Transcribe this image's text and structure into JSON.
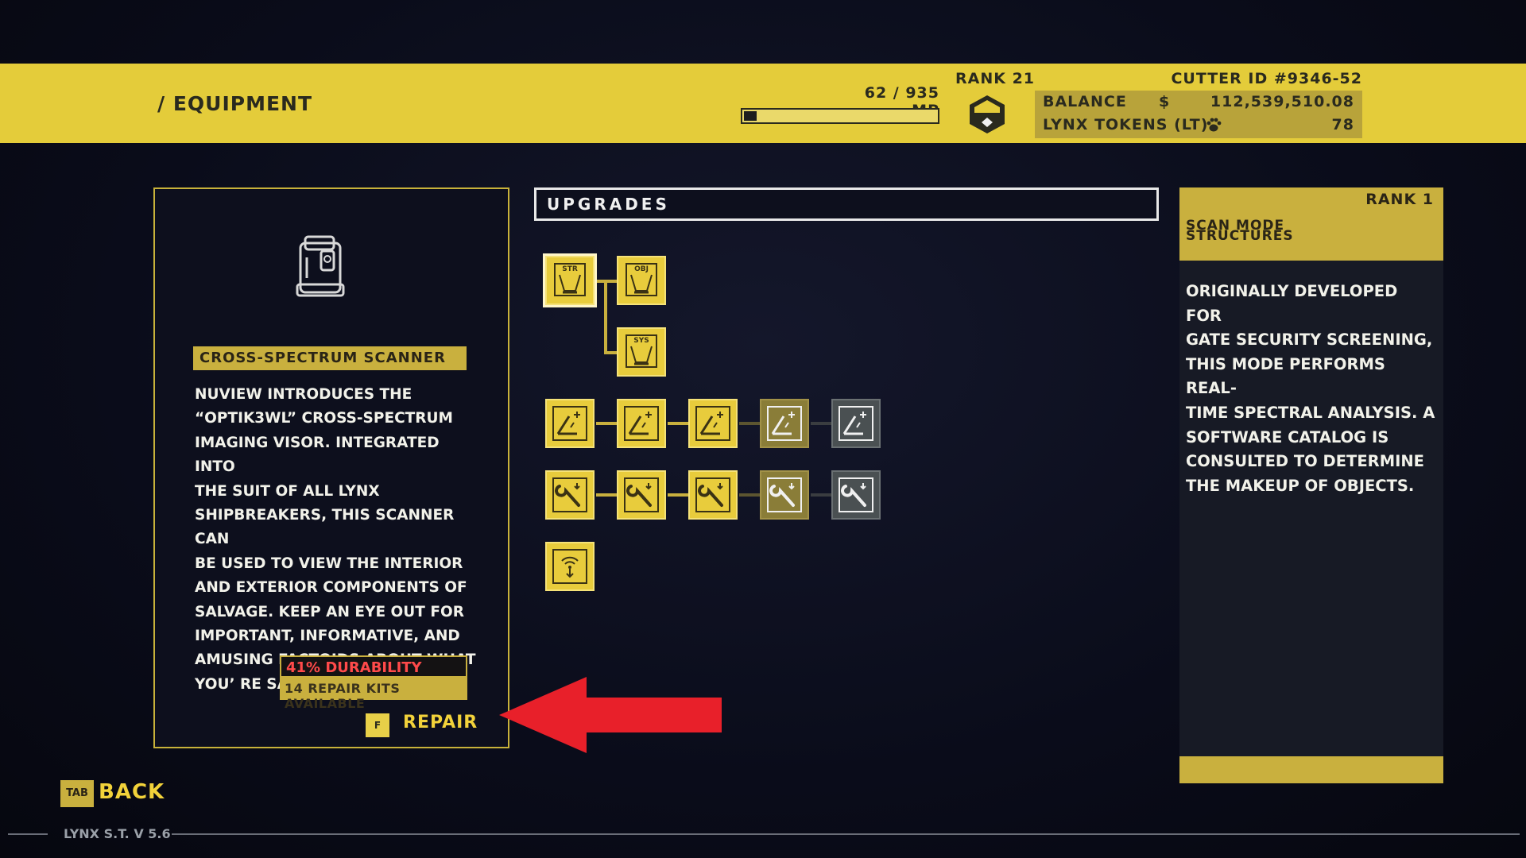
{
  "header": {
    "title": "/ EQUIPMENT",
    "mp_text": "62 / 935 MP",
    "mp_progress": 0.066,
    "rank_text": "RANK 21",
    "cutter_id": "CUTTER ID  #9346-52",
    "balance_label": "BALANCE",
    "balance_currency": "$",
    "balance_value": "112,539,510.08",
    "tokens_label": "LYNX TOKENS  (LT)",
    "tokens_value": "78"
  },
  "item": {
    "name": "CROSS-SPECTRUM SCANNER",
    "description": "NUVIEW INTRODUCES THE\n  “OPTIK3WL”   CROSS-SPECTRUM\nIMAGING VISOR. INTEGRATED INTO\nTHE SUIT OF ALL LYNX\nSHIPBREAKERS, THIS SCANNER CAN\nBE USED TO VIEW THE INTERIOR\nAND EXTERIOR COMPONENTS OF\nSALVAGE. KEEP AN EYE OUT FOR\nIMPORTANT, INFORMATIVE, AND\nAMUSING FACTOIDS ABOUT WHAT\nYOU’   RE SALVAGING!",
    "durability": "41% DURABILITY",
    "repair_kits": "14 REPAIR KITS AVAILABLE",
    "repair_key": "F",
    "repair_label": "REPAIR"
  },
  "upgrades": {
    "title": "UPGRADES",
    "node_labels": {
      "str": "STR",
      "obj": "OBJ",
      "sys": "SYS"
    }
  },
  "detail": {
    "rank": "RANK  1",
    "title_line1": "SCAN MODE",
    "title_line2": "STRUCTURES",
    "description": "ORIGINALLY DEVELOPED FOR\nGATE SECURITY SCREENING,\nTHIS MODE PERFORMS REAL-\nTIME SPECTRAL ANALYSIS. A\nSOFTWARE CATALOG IS\nCONSULTED TO DETERMINE\nTHE MAKEUP OF OBJECTS."
  },
  "footer": {
    "back_key": "TAB",
    "back_label": "BACK",
    "version": "LYNX S.T. V 5.6"
  },
  "colors": {
    "accent": "#e4cc3a",
    "background": "#0a0c1a",
    "durability": "#ff4a4a",
    "annotation_arrow": "#e8202a"
  }
}
